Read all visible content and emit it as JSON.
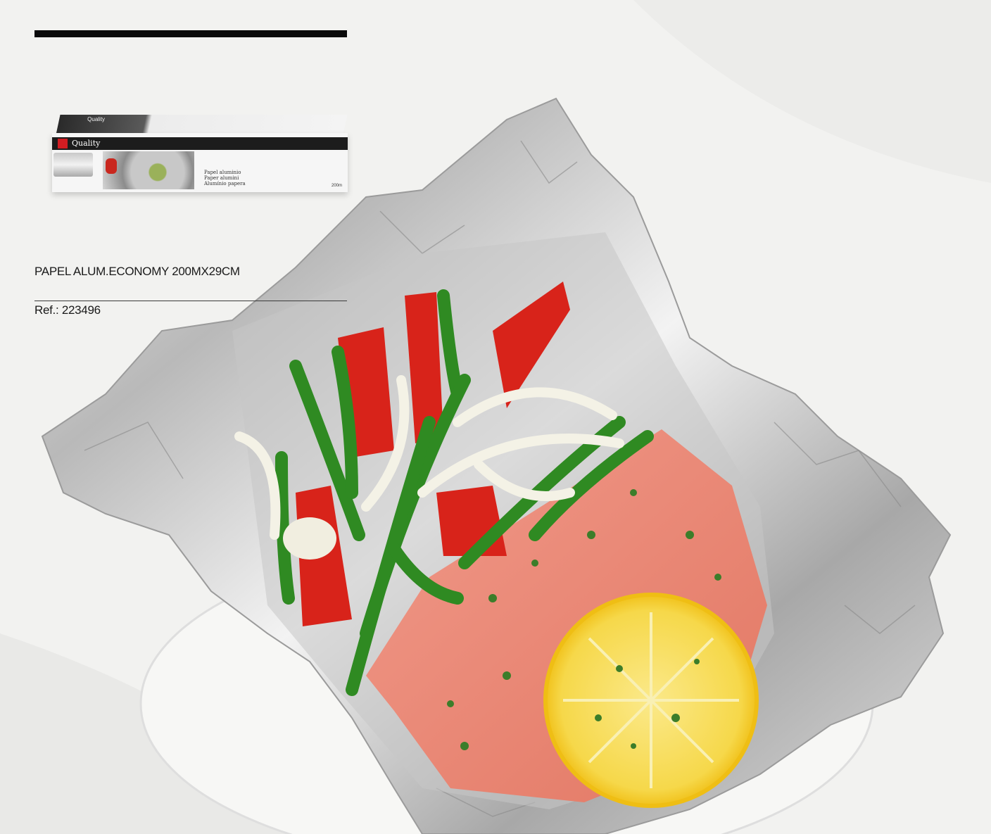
{
  "product": {
    "name": "PAPEL ALUM.ECONOMY 200MX29CM",
    "reference": "Ref.: 223496"
  },
  "package": {
    "brand": "Quality",
    "lines": [
      "Papel aluminio",
      "Paper alumini",
      "Alumínio papera"
    ],
    "size": "200m"
  },
  "photo": {
    "subject": "salmon-in-foil"
  },
  "colors": {
    "background": "#f2f2f0",
    "rule": "#0a0a0a",
    "brand_red": "#d11d22"
  }
}
